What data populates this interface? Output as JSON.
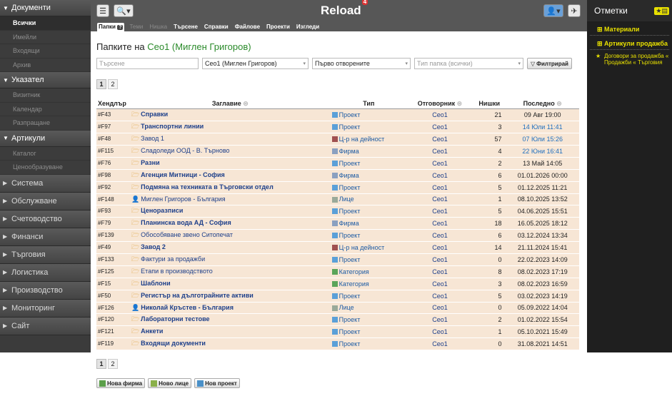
{
  "app": {
    "title": "Reload",
    "badge": "4"
  },
  "left_nav": [
    {
      "type": "section",
      "label": "Документи",
      "open": true
    },
    {
      "type": "item",
      "label": "Всички",
      "active": true
    },
    {
      "type": "item",
      "label": "Имейли"
    },
    {
      "type": "item",
      "label": "Входящи"
    },
    {
      "type": "item",
      "label": "Архив"
    },
    {
      "type": "section",
      "label": "Указател",
      "open": true
    },
    {
      "type": "item",
      "label": "Визитник"
    },
    {
      "type": "item",
      "label": "Календар"
    },
    {
      "type": "item",
      "label": "Разпращане"
    },
    {
      "type": "section",
      "label": "Артикули",
      "open": true
    },
    {
      "type": "item",
      "label": "Каталог"
    },
    {
      "type": "item",
      "label": "Ценообразуване"
    },
    {
      "type": "section",
      "label": "Система",
      "open": false
    },
    {
      "type": "section",
      "label": "Обслужване",
      "open": false
    },
    {
      "type": "section",
      "label": "Счетоводство",
      "open": false
    },
    {
      "type": "section",
      "label": "Финанси",
      "open": false
    },
    {
      "type": "section",
      "label": "Търговия",
      "open": false
    },
    {
      "type": "section",
      "label": "Логистика",
      "open": false
    },
    {
      "type": "section",
      "label": "Производство",
      "open": false
    },
    {
      "type": "section",
      "label": "Мониторинг",
      "open": false
    },
    {
      "type": "section",
      "label": "Сайт",
      "open": false
    }
  ],
  "tabs": [
    {
      "label": "Папки",
      "q": "?",
      "state": "sel"
    },
    {
      "label": "Теми",
      "state": "off"
    },
    {
      "label": "Нишка",
      "state": "off"
    },
    {
      "label": "Търсене",
      "state": "on"
    },
    {
      "label": "Справки",
      "state": "on"
    },
    {
      "label": "Файлове",
      "state": "on"
    },
    {
      "label": "Проекти",
      "state": "on"
    },
    {
      "label": "Изгледи",
      "state": "on"
    }
  ],
  "right_panel": {
    "title": "Отметки",
    "items": [
      "Материали",
      "Артикули продажба"
    ],
    "starred": "Договори за продажба « Продажби « Търговия"
  },
  "main": {
    "heading_prefix": "Папките на ",
    "heading_owner": "Сео1 (Миглен Григоров)",
    "filters": {
      "search_placeholder": "Търсене",
      "user": "Сео1 (Миглен Григоров)",
      "order": "Първо отворените",
      "type_placeholder": "Тип папка (всички)",
      "button": "Филтрирай"
    },
    "pages": [
      "1",
      "2"
    ],
    "columns": {
      "handle": "Хендлър",
      "title": "Заглавие",
      "type": "Тип",
      "owner": "Отговорник",
      "threads": "Нишки",
      "last": "Последно"
    },
    "rows": [
      {
        "h": "#F43",
        "t": "Справки",
        "b": true,
        "type": "Проект",
        "ic": "proj",
        "o": "Сео1",
        "n": "21",
        "d": "09 Авг 19:00",
        "blue": false
      },
      {
        "h": "#F97",
        "t": "Транспортни линии",
        "b": true,
        "type": "Проект",
        "ic": "proj",
        "o": "Сео1",
        "n": "3",
        "d": "14 Юли 11:41",
        "blue": true
      },
      {
        "h": "#F48",
        "t": "Завод 1",
        "b": false,
        "type": "Ц-р на дейност",
        "ic": "ctr",
        "o": "Сео1",
        "n": "57",
        "d": "07 Юли 15:26",
        "blue": true
      },
      {
        "h": "#F115",
        "t": "Сладоледи ООД - В. Търново",
        "b": false,
        "type": "Фирма",
        "ic": "firm",
        "o": "Сео1",
        "n": "4",
        "d": "22 Юни 16:41",
        "blue": true
      },
      {
        "h": "#F76",
        "t": "Разни",
        "b": true,
        "type": "Проект",
        "ic": "proj",
        "o": "Сео1",
        "n": "2",
        "d": "13 Май 14:05",
        "blue": false
      },
      {
        "h": "#F98",
        "t": "Агенция Митници - София",
        "b": true,
        "type": "Фирма",
        "ic": "firm",
        "o": "Сео1",
        "n": "6",
        "d": "01.01.2026 00:00",
        "blue": false
      },
      {
        "h": "#F92",
        "t": "Подмяна на техниката в Търговски отдел",
        "b": true,
        "type": "Проект",
        "ic": "proj",
        "o": "Сео1",
        "n": "5",
        "d": "01.12.2025 11:21",
        "blue": false
      },
      {
        "h": "#F148",
        "t": "Миглен Григоров - България",
        "b": false,
        "type": "Лице",
        "ic": "pers",
        "o": "Сео1",
        "n": "1",
        "d": "08.10.2025 13:52",
        "blue": false
      },
      {
        "h": "#F93",
        "t": "Ценоразписи",
        "b": true,
        "type": "Проект",
        "ic": "proj",
        "o": "Сео1",
        "n": "5",
        "d": "04.06.2025 15:51",
        "blue": false
      },
      {
        "h": "#F79",
        "t": "Планинска вода АД - София",
        "b": true,
        "type": "Фирма",
        "ic": "firm",
        "o": "Сео1",
        "n": "18",
        "d": "16.05.2025 18:12",
        "blue": false
      },
      {
        "h": "#F139",
        "t": "Обособяване звено Ситопечат",
        "b": false,
        "type": "Проект",
        "ic": "proj",
        "o": "Сео1",
        "n": "6",
        "d": "03.12.2024 13:34",
        "blue": false
      },
      {
        "h": "#F49",
        "t": "Завод 2",
        "b": true,
        "type": "Ц-р на дейност",
        "ic": "ctr",
        "o": "Сео1",
        "n": "14",
        "d": "21.11.2024 15:41",
        "blue": false
      },
      {
        "h": "#F133",
        "t": "Фактури за продажби",
        "b": false,
        "type": "Проект",
        "ic": "proj",
        "o": "Сео1",
        "n": "0",
        "d": "22.02.2023 14:09",
        "blue": false
      },
      {
        "h": "#F125",
        "t": "Етапи в производството",
        "b": false,
        "type": "Категория",
        "ic": "cat",
        "o": "Сео1",
        "n": "8",
        "d": "08.02.2023 17:19",
        "blue": false
      },
      {
        "h": "#F15",
        "t": "Шаблони",
        "b": true,
        "type": "Категория",
        "ic": "cat",
        "o": "Сео1",
        "n": "3",
        "d": "08.02.2023 16:59",
        "blue": false
      },
      {
        "h": "#F50",
        "t": "Регистър на дълготрайните активи",
        "b": true,
        "type": "Проект",
        "ic": "proj",
        "o": "Сео1",
        "n": "5",
        "d": "03.02.2023 14:19",
        "blue": false
      },
      {
        "h": "#F126",
        "t": "Николай Кръстев - България",
        "b": true,
        "type": "Лице",
        "ic": "pers",
        "o": "Сео1",
        "n": "0",
        "d": "05.09.2022 14:04",
        "blue": false
      },
      {
        "h": "#F120",
        "t": "Лабораторни тестове",
        "b": true,
        "type": "Проект",
        "ic": "proj",
        "o": "Сео1",
        "n": "2",
        "d": "01.02.2022 15:54",
        "blue": false
      },
      {
        "h": "#F121",
        "t": "Анкети",
        "b": true,
        "type": "Проект",
        "ic": "proj",
        "o": "Сео1",
        "n": "1",
        "d": "05.10.2021 15:49",
        "blue": false
      },
      {
        "h": "#F119",
        "t": "Входящи документи",
        "b": true,
        "type": "Проект",
        "ic": "proj",
        "o": "Сео1",
        "n": "0",
        "d": "31.08.2021 14:51",
        "blue": false
      }
    ],
    "bottom_buttons": [
      "Нова фирма",
      "Ново лице",
      "Нов проект"
    ]
  },
  "colors": {
    "row": "#f7e6d5",
    "link": "#1d3f8a",
    "green": "#2a8a2a",
    "accent": "#e8e000"
  }
}
